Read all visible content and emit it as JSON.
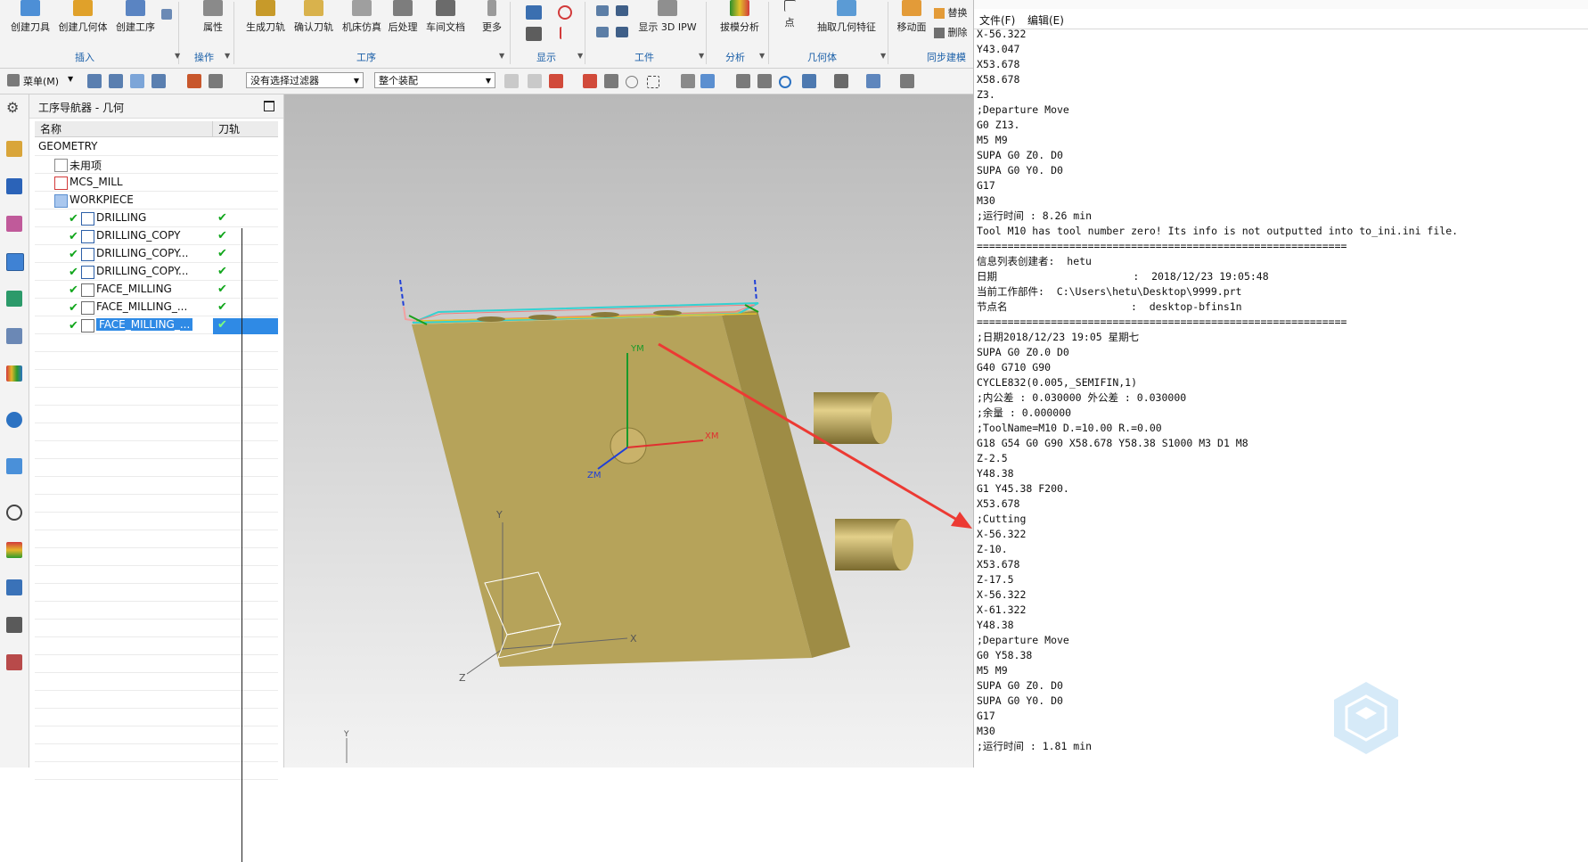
{
  "ribbon": {
    "buttons": [
      {
        "label": "创建刀具",
        "icon": "create-tool-icon"
      },
      {
        "label": "创建几何体",
        "icon": "create-geometry-icon"
      },
      {
        "label": "创建工序",
        "icon": "create-operation-icon"
      },
      {
        "label": "属性",
        "icon": "properties-icon"
      },
      {
        "label": "生成刀轨",
        "icon": "generate-toolpath-icon"
      },
      {
        "label": "确认刀轨",
        "icon": "verify-toolpath-icon"
      },
      {
        "label": "机床仿真",
        "icon": "machine-simulation-icon"
      },
      {
        "label": "后处理",
        "icon": "postprocess-icon"
      },
      {
        "label": "车间文档",
        "icon": "shop-documentation-icon"
      },
      {
        "label": "更多",
        "icon": "more-icon"
      },
      {
        "label": "显示 3D IPW",
        "icon": "show-3d-ipw-icon"
      },
      {
        "label": "拔模分析",
        "icon": "draft-analysis-icon"
      },
      {
        "label": "点",
        "icon": "point-icon"
      },
      {
        "label": "抽取几何特征",
        "icon": "extract-geometry-icon"
      },
      {
        "label": "移动面",
        "icon": "move-face-icon"
      }
    ],
    "small_buttons": [
      "替换",
      "删除"
    ],
    "groups": [
      "插入",
      "操作",
      "工序",
      "显示",
      "工件",
      "分析",
      "几何体",
      "同步建模"
    ]
  },
  "toolbar2": {
    "menu_label": "菜单(M)",
    "filter_select": "没有选择过滤器",
    "assembly_select": "整个装配"
  },
  "navigator": {
    "title": "工序导航器 - 几何",
    "columns": [
      "名称",
      "刀轨"
    ],
    "rows": [
      {
        "name": "GEOMETRY",
        "level": 0,
        "icon": "",
        "check": false,
        "op_check": false
      },
      {
        "name": "未用项",
        "level": 1,
        "icon": "unused-items-icon",
        "check": false,
        "op_check": false
      },
      {
        "name": "MCS_MILL",
        "level": 1,
        "icon": "mcs-icon",
        "check": false,
        "op_check": false
      },
      {
        "name": "WORKPIECE",
        "level": 2,
        "icon": "workpiece-icon",
        "check": false,
        "op_check": false
      },
      {
        "name": "DRILLING",
        "level": 3,
        "icon": "drilling-op-icon",
        "check": true,
        "op_check": true
      },
      {
        "name": "DRILLING_COPY",
        "level": 3,
        "icon": "drilling-op-icon",
        "check": true,
        "op_check": true
      },
      {
        "name": "DRILLING_COPY...",
        "level": 3,
        "icon": "drilling-op-icon",
        "check": true,
        "op_check": true
      },
      {
        "name": "DRILLING_COPY...",
        "level": 3,
        "icon": "drilling-op-icon",
        "check": true,
        "op_check": true
      },
      {
        "name": "FACE_MILLING",
        "level": 3,
        "icon": "face-milling-op-icon",
        "check": true,
        "op_check": true
      },
      {
        "name": "FACE_MILLING_...",
        "level": 3,
        "icon": "face-milling-op-icon",
        "check": true,
        "op_check": true
      },
      {
        "name": "FACE_MILLING_...",
        "level": 3,
        "icon": "face-milling-op-icon",
        "check": true,
        "op_check": true,
        "selected": true
      }
    ]
  },
  "viewport": {
    "axis_labels": {
      "x": "X",
      "y": "Y",
      "z": "Z"
    },
    "wcs_labels": {
      "xm": "XM",
      "ym": "YM",
      "zm": "ZM"
    }
  },
  "info_window": {
    "menu": [
      "文件(F)",
      "编辑(E)"
    ],
    "lines": [
      "X-56.322",
      "Y43.047",
      "X53.678",
      "X58.678",
      "Z3.",
      ";Departure Move",
      "G0 Z13.",
      "M5 M9",
      "SUPA G0 Z0. D0",
      "SUPA G0 Y0. D0",
      "G17",
      "M30",
      ";运行时间 : 8.26 min",
      "Tool M10 has tool number zero! Its info is not outputted into to_ini.ini file.",
      "============================================================",
      "信息列表创建者:  hetu",
      "日期                      :  2018/12/23 19:05:48",
      "当前工作部件:  C:\\Users\\hetu\\Desktop\\9999.prt",
      "节点名                    :  desktop-bfins1n",
      "============================================================",
      ";日期2018/12/23 19:05 星期七",
      "SUPA G0 Z0.0 D0",
      "G40 G710 G90",
      "CYCLE832(0.005,_SEMIFIN,1)",
      ";内公差 : 0.030000 外公差 : 0.030000",
      ";余量 : 0.000000",
      ";ToolName=M10 D.=10.00 R.=0.00",
      "G18 G54 G0 G90 X58.678 Y58.38 S1000 M3 D1 M8",
      "Z-2.5",
      "Y48.38",
      "G1 Y45.38 F200.",
      "X53.678",
      ";Cutting",
      "X-56.322",
      "Z-10.",
      "X53.678",
      "Z-17.5",
      "X-56.322",
      "X-61.322",
      "Y48.38",
      ";Departure Move",
      "G0 Y58.38",
      "M5 M9",
      "SUPA G0 Z0. D0",
      "SUPA G0 Y0. D0",
      "G17",
      "M30",
      ";运行时间 : 1.81 min"
    ]
  },
  "colors": {
    "accent": "#1a5fa8",
    "selection": "#2f8ae5",
    "check": "#11a61c",
    "part": "#b6a35a",
    "arrow": "#ec3a33"
  }
}
